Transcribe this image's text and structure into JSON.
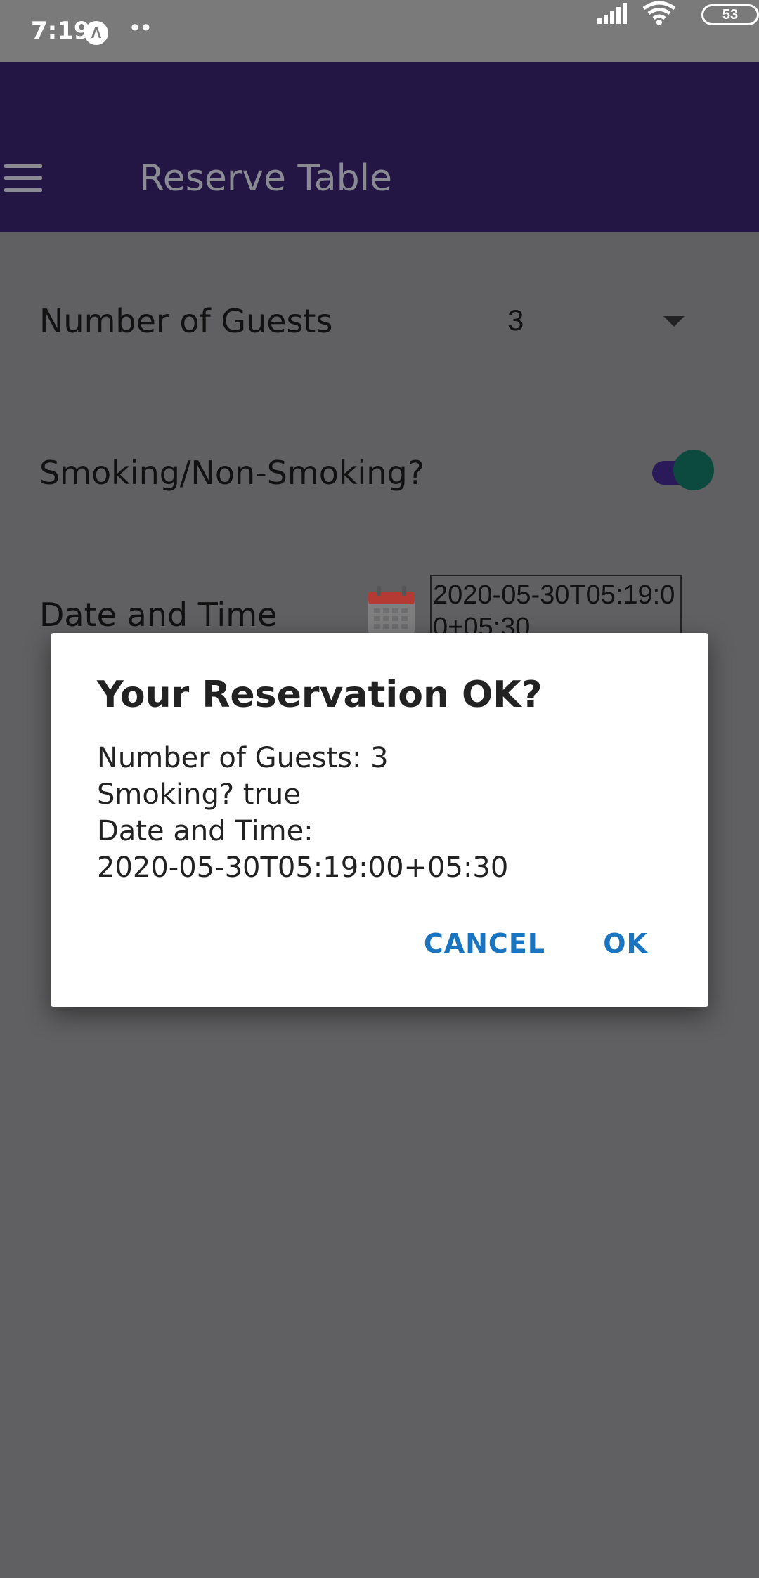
{
  "status_bar": {
    "time": "7:19",
    "app_icon_glyph": "Λ",
    "dots": "••",
    "battery": "53"
  },
  "app_bar": {
    "title": "Reserve Table"
  },
  "form": {
    "guests_label": "Number of Guests",
    "guests_value": "3",
    "smoking_label": "Smoking/Non-Smoking?",
    "datetime_label": "Date and Time",
    "datetime_value": "2020-05-30T05:19:00+05:30"
  },
  "dialog": {
    "title": "Your Reservation OK?",
    "lines": [
      "Number of Guests: 3",
      "Smoking? true",
      "Date and Time:",
      "2020-05-30T05:19:00+05:30"
    ],
    "cancel_label": "CANCEL",
    "ok_label": "OK"
  },
  "colors": {
    "app_bar": "#231645",
    "accent_button": "#1b74bf",
    "calendar": "#b53a33",
    "switch_thumb": "#0c4a40"
  },
  "icons": [
    "menu-icon",
    "signal-icon",
    "wifi-icon",
    "calendar-icon",
    "chevron-down-icon"
  ]
}
